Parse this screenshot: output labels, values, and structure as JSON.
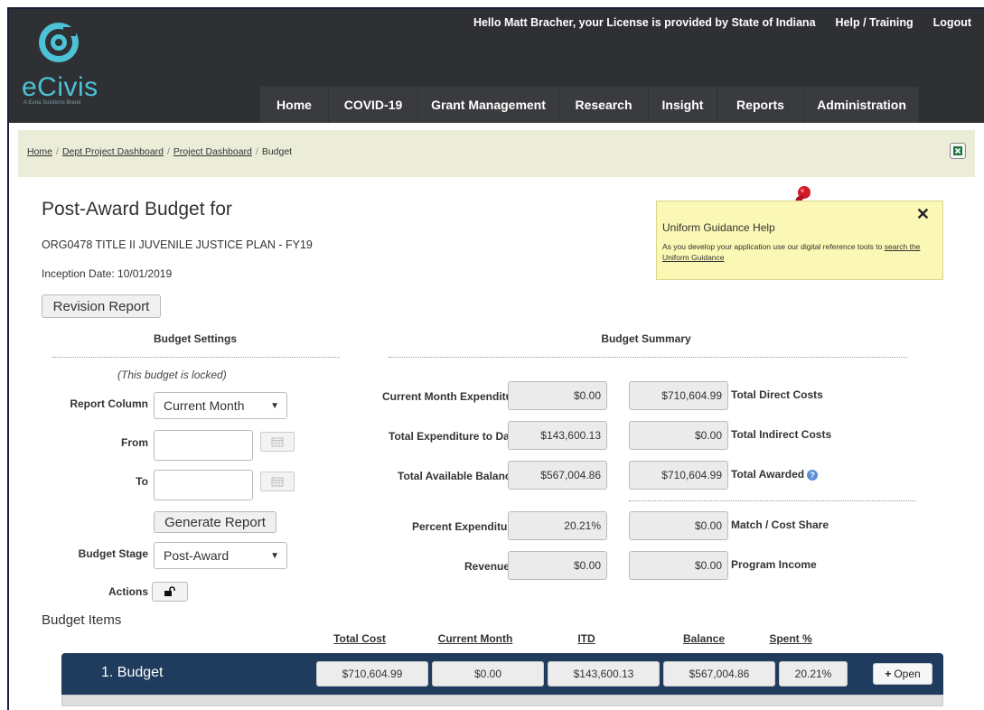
{
  "header": {
    "logo_text": "eCivis",
    "logo_tagline": "A Euna Solutions Brand",
    "greeting": "Hello Matt Bracher, your License is provided by State of Indiana",
    "help_link": "Help / Training",
    "logout_link": "Logout",
    "colors": {
      "bar": "#2f3033",
      "brand": "#4cc2d6"
    }
  },
  "nav": [
    "Home",
    "COVID-19",
    "Grant Management",
    "Research",
    "Insight",
    "Reports",
    "Administration"
  ],
  "breadcrumb": {
    "items": [
      "Home",
      "Dept Project Dashboard",
      "Project Dashboard"
    ],
    "current": "Budget",
    "separator": "/"
  },
  "page": {
    "title": "Post-Award Budget for",
    "grant_name": "ORG0478 TITLE II JUVENILE JUSTICE PLAN - FY19",
    "inception": "Inception Date: 10/01/2019",
    "revision_button": "Revision Report"
  },
  "help_box": {
    "title": "Uniform Guidance Help",
    "body": "As you develop your application use our digital reference tools to ",
    "link": "search the Uniform Guidance",
    "close": "✕"
  },
  "settings": {
    "heading": "Budget Settings",
    "locked_note": "(This budget is locked)",
    "report_column_label": "Report Column",
    "report_column_value": "Current Month",
    "from_label": "From",
    "to_label": "To",
    "generate_button": "Generate Report",
    "stage_label": "Budget Stage",
    "stage_value": "Post-Award",
    "actions_label": "Actions"
  },
  "summary": {
    "heading": "Budget Summary",
    "left": [
      {
        "label": "Current Month Expenditure",
        "value": "$0.00"
      },
      {
        "label": "Total Expenditure to Date",
        "value": "$143,600.13"
      },
      {
        "label": "Total Available Balance",
        "value": "$567,004.86"
      },
      {
        "label": "Percent Expenditure",
        "value": "20.21%"
      },
      {
        "label": "Revenue",
        "value": "$0.00"
      }
    ],
    "right": [
      {
        "label": "Total Direct Costs",
        "value": "$710,604.99"
      },
      {
        "label": "Total Indirect Costs",
        "value": "$0.00"
      },
      {
        "label": "Total Awarded",
        "value": "$710,604.99"
      },
      {
        "label": "Match / Cost Share",
        "value": "$0.00"
      },
      {
        "label": "Program Income",
        "value": "$0.00"
      }
    ]
  },
  "budget_items": {
    "title": "Budget Items",
    "columns": [
      "Total Cost",
      "Current Month",
      "ITD",
      "Balance",
      "Spent %"
    ],
    "rows": [
      {
        "label": "1. Budget",
        "values": [
          "$710,604.99",
          "$0.00",
          "$143,600.13",
          "$567,004.86",
          "20.21%"
        ],
        "open_label": "Open"
      }
    ]
  }
}
